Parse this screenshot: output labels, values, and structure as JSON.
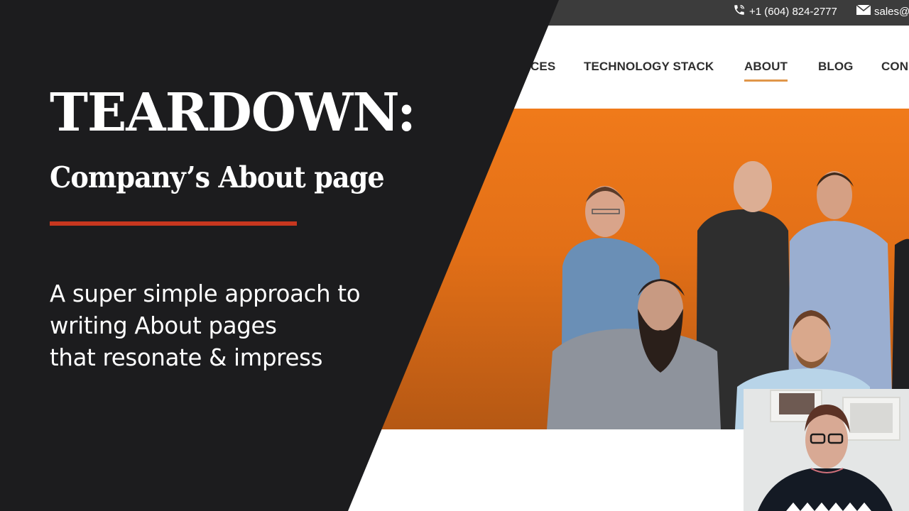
{
  "website": {
    "topbar": {
      "phone": "+1 (604) 824-2777",
      "phone_icon": "phone-icon",
      "email": "sales@",
      "email_icon": "envelope-icon",
      "background_color": "#3c3c3c"
    },
    "nav": {
      "items": [
        {
          "label": "CES",
          "active": false
        },
        {
          "label": "TECHNOLOGY STACK",
          "active": false
        },
        {
          "label": "ABOUT",
          "active": true
        },
        {
          "label": "BLOG",
          "active": false
        },
        {
          "label": "CON",
          "active": false
        }
      ],
      "active_underline_color": "#e0964a"
    },
    "hero": {
      "background_color": "#f07a1a",
      "image": "team-photo"
    }
  },
  "overlay": {
    "title": "TEARDOWN:",
    "subtitle": "Company’s About page",
    "accent_color": "#c7371f",
    "tagline_lines": [
      "A super simple approach to",
      "writing About pages",
      "that resonate & impress"
    ],
    "panel_color": "#1c1c1e"
  },
  "webcam": {
    "image": "presenter-webcam"
  }
}
